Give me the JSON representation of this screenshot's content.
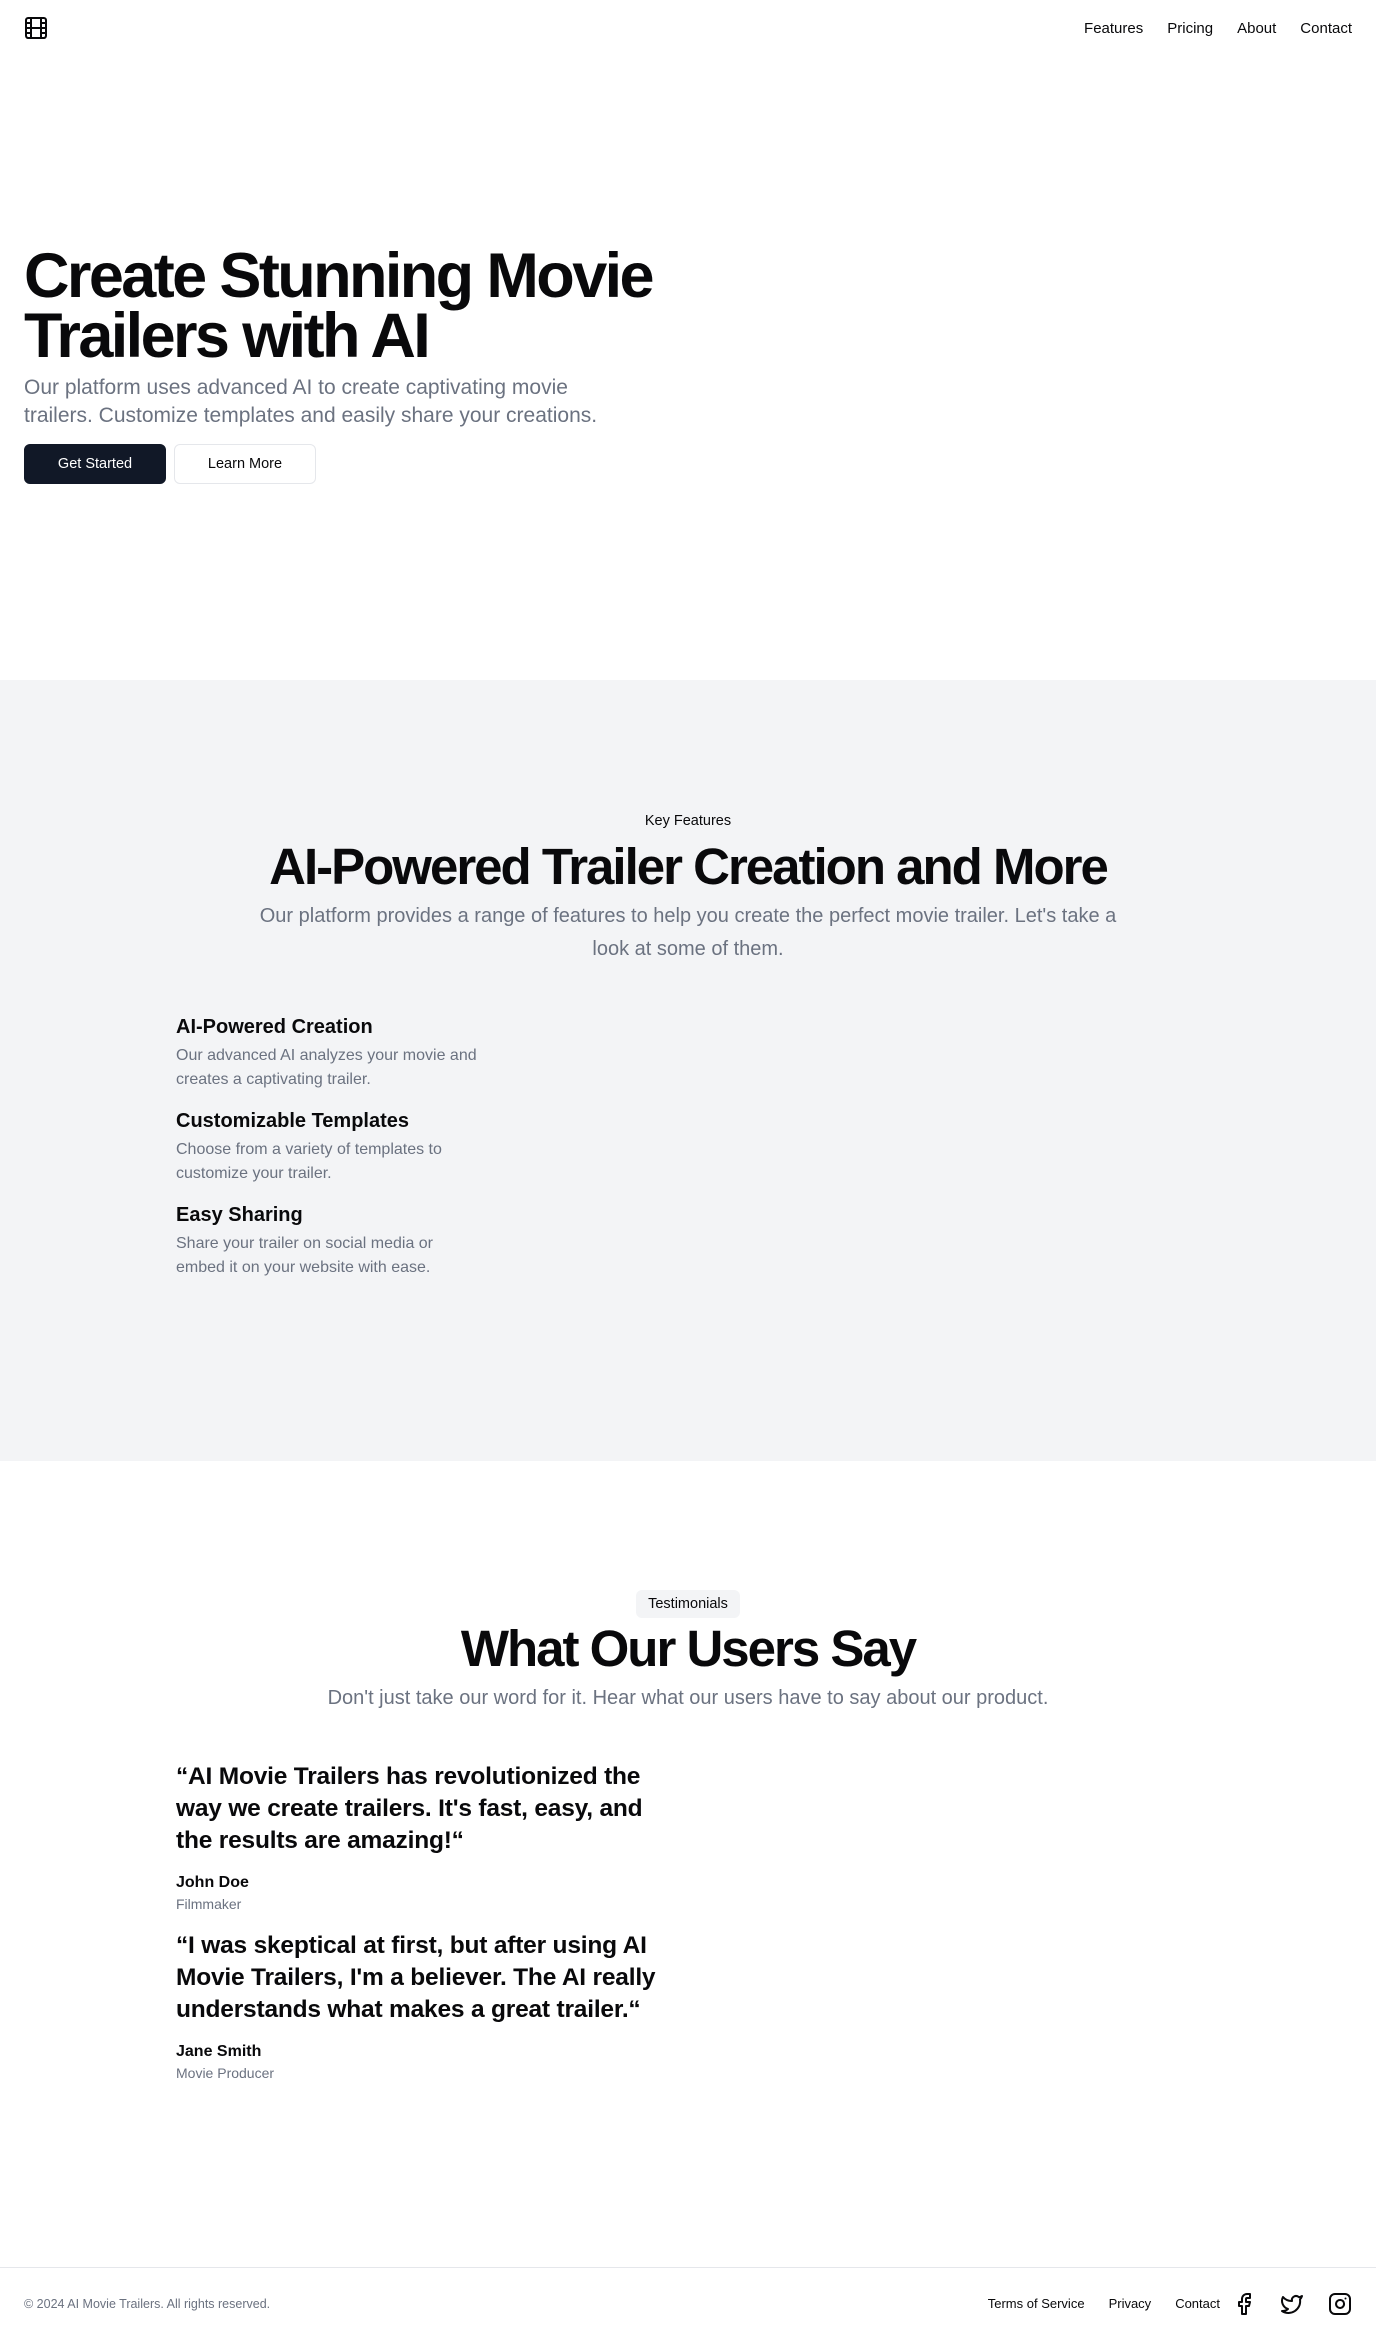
{
  "header": {
    "logo_icon": "film-icon",
    "nav": [
      "Features",
      "Pricing",
      "About",
      "Contact"
    ]
  },
  "hero": {
    "title_line1": "Create Stunning Movie",
    "title_line2": "Trailers with AI",
    "subtitle": "Our platform uses advanced AI to create captivating movie trailers. Customize templates and easily share your creations.",
    "primary_button": "Get Started",
    "secondary_button": "Learn More"
  },
  "features": {
    "label": "Key Features",
    "title": "AI-Powered Trailer Creation and More",
    "subtitle": "Our platform provides a range of features to help you create the perfect movie trailer. Let's take a look at some of them.",
    "items": [
      {
        "title": "AI-Powered Creation",
        "description": "Our advanced AI analyzes your movie and creates a captivating trailer."
      },
      {
        "title": "Customizable Templates",
        "description": "Choose from a variety of templates to customize your trailer."
      },
      {
        "title": "Easy Sharing",
        "description": "Share your trailer on social media or embed it on your website with ease."
      }
    ]
  },
  "testimonials": {
    "badge": "Testimonials",
    "title": "What Our Users Say",
    "subtitle": "Don't just take our word for it. Hear what our users have to say about our product.",
    "items": [
      {
        "quote": "“AI Movie Trailers has revolutionized the way we create trailers. It's fast, easy, and the results are amazing!“",
        "name": "John Doe",
        "role": "Filmmaker"
      },
      {
        "quote": "“I was skeptical at first, but after using AI Movie Trailers, I'm a believer. The AI really understands what makes a great trailer.“",
        "name": "Jane Smith",
        "role": "Movie Producer"
      }
    ]
  },
  "footer": {
    "copyright": "© 2024 AI Movie Trailers. All rights reserved.",
    "links": [
      "Terms of Service",
      "Privacy",
      "Contact"
    ],
    "social_icons": [
      "facebook-icon",
      "twitter-icon",
      "instagram-icon"
    ]
  }
}
